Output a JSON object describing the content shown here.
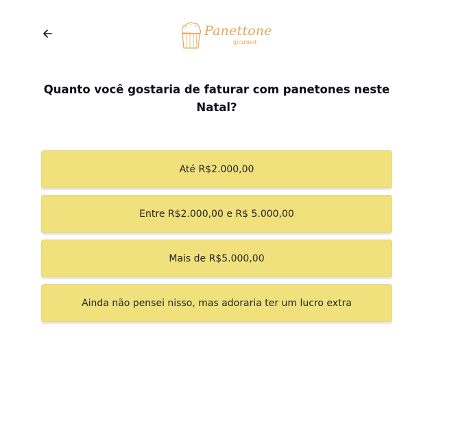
{
  "header": {
    "back_icon": "arrow-left-icon",
    "logo": {
      "text": "Panettone",
      "subtext": "gourmet",
      "color": "#e3a85b"
    }
  },
  "question": {
    "text": "Quanto você gostaria de faturar com panetones neste Natal?"
  },
  "options": [
    {
      "label": "Até R$2.000,00"
    },
    {
      "label": "Entre R$2.000,00 e R$ 5.000,00"
    },
    {
      "label": "Mais de R$5.000,00"
    },
    {
      "label": "Ainda não pensei nisso, mas adoraria ter um lucro extra"
    }
  ],
  "colors": {
    "option_background": "#f1e17d",
    "accent": "#e3a85b",
    "text": "#0f0f1e"
  }
}
